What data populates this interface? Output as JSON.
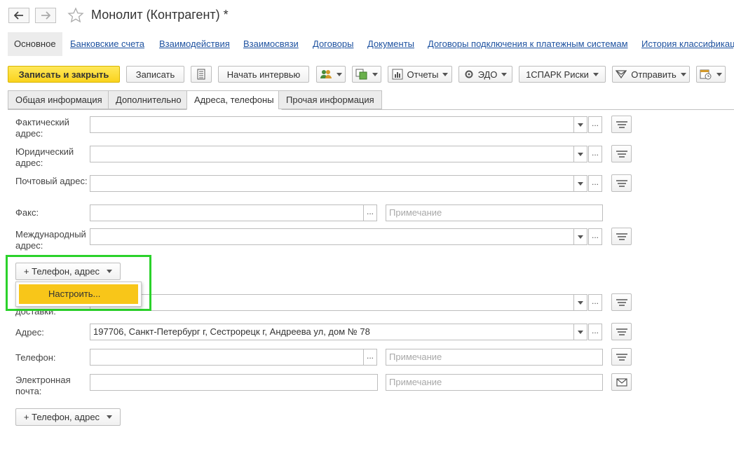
{
  "window": {
    "title": "Монолит (Контрагент) *"
  },
  "linkbar": {
    "items": [
      {
        "label": "Основное",
        "active": true
      },
      {
        "label": "Банковские счета"
      },
      {
        "label": "Взаимодействия"
      },
      {
        "label": "Взаимосвязи"
      },
      {
        "label": "Договоры"
      },
      {
        "label": "Документы"
      },
      {
        "label": "Договоры подключения к платежным системам"
      },
      {
        "label": "История классификаци"
      }
    ]
  },
  "toolbar": {
    "save_close": "Записать и закрыть",
    "save": "Записать",
    "interview": "Начать интервью",
    "reports": "Отчеты",
    "edo": "ЭДО",
    "spark": "1СПАРК Риски",
    "send": "Отправить"
  },
  "tabs": [
    {
      "label": "Общая информация"
    },
    {
      "label": "Дополнительно"
    },
    {
      "label": "Адреса, телефоны",
      "active": true
    },
    {
      "label": "Прочая информация"
    }
  ],
  "form": {
    "actual_address_label": "Фактический адрес:",
    "legal_address_label": "Юридический адрес:",
    "postal_address_label": "Почтовый адрес:",
    "fax_label": "Факс:",
    "international_address_label": "Международный адрес:",
    "delivery_label_partial": "доставки:",
    "address_label": "Адрес:",
    "address_value": "197706, Санкт-Петербург г, Сестрорецк г, Андреева ул, дом № 78",
    "phone_label": "Телефон:",
    "email_label": "Электронная почта:",
    "note_placeholder": "Примечание",
    "add_contact_label": "+ Телефон, адрес",
    "configure_label": "Настроить..."
  },
  "colors": {
    "accent_yellow": "#fad31d",
    "link_blue": "#1e52a0",
    "highlight_green": "#2bd22b"
  }
}
